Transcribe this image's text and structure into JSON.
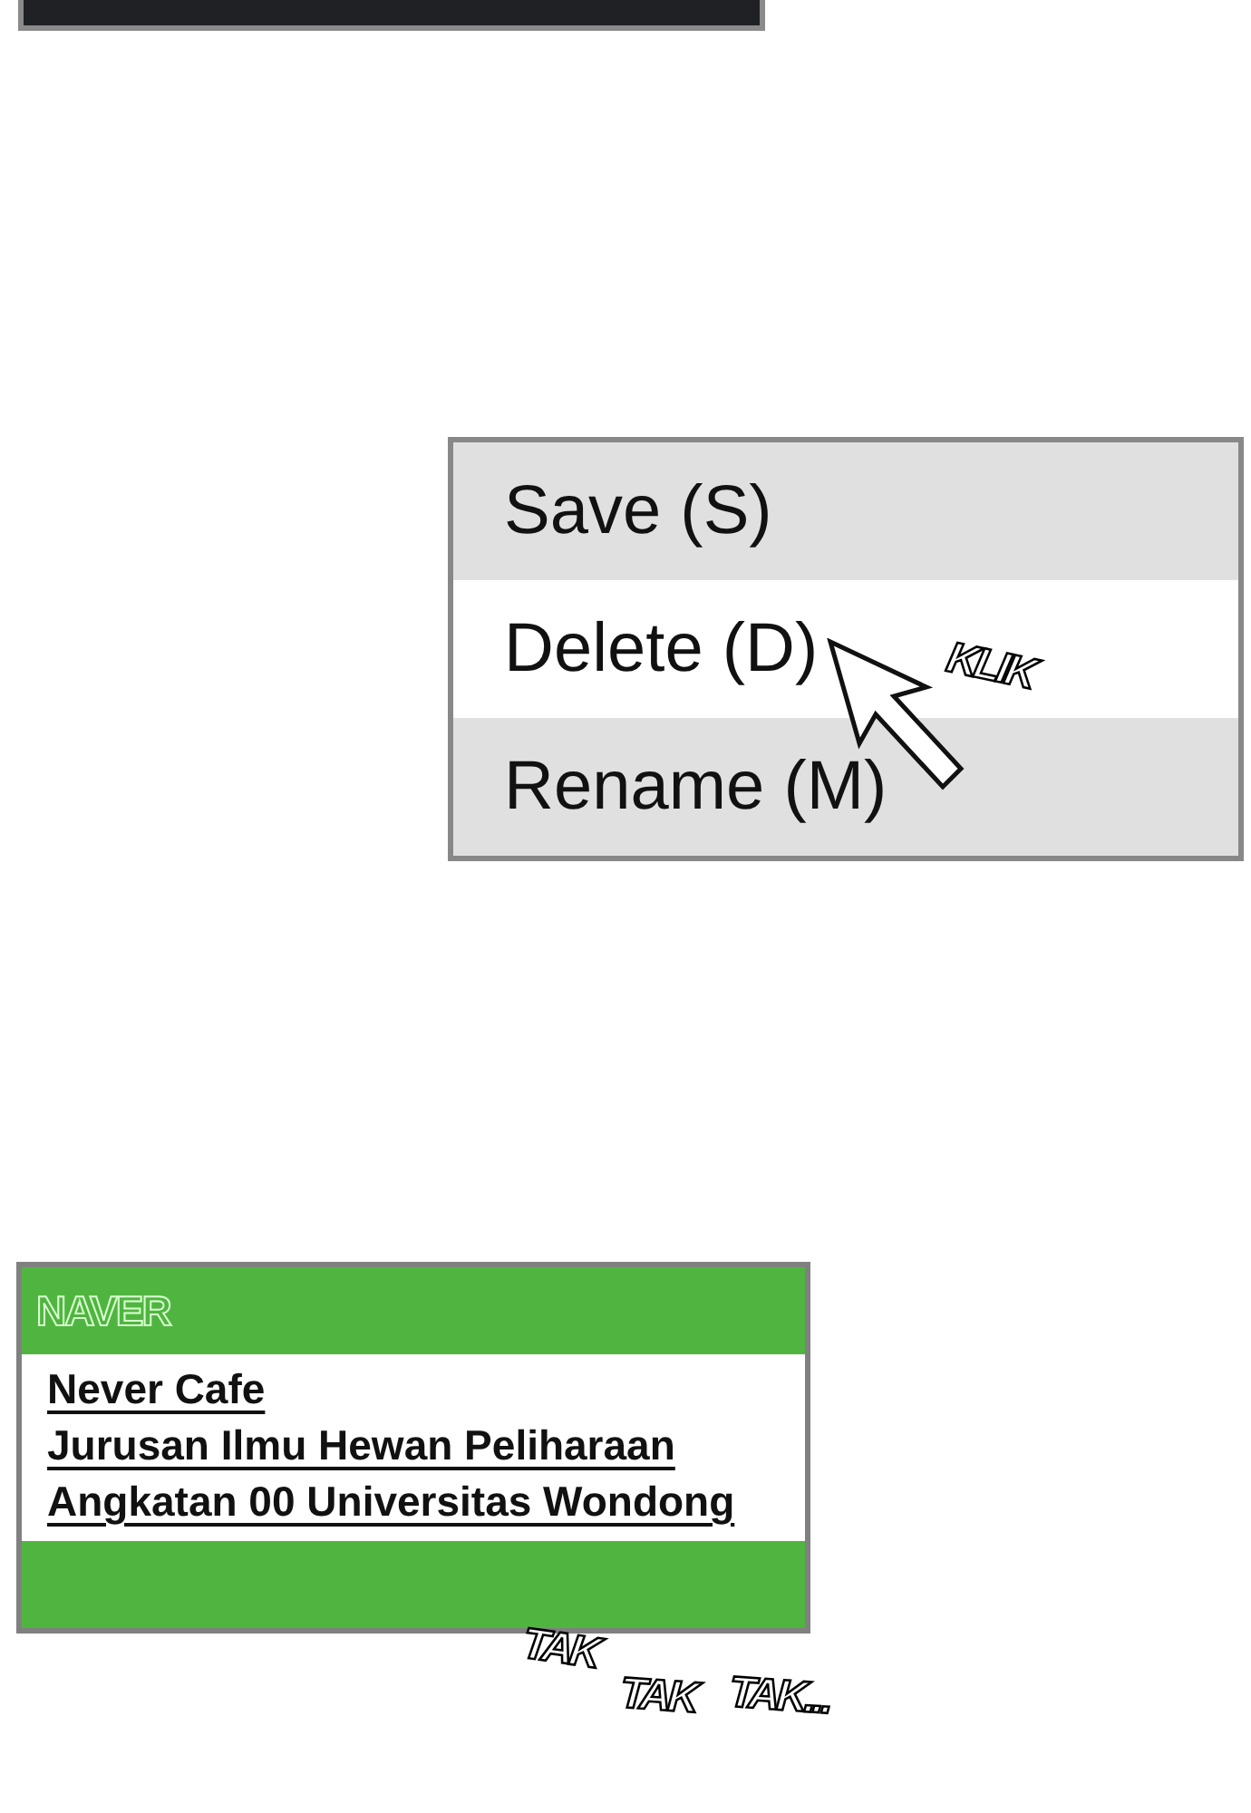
{
  "top_bar": {
    "kind": "dark"
  },
  "menu": {
    "items": [
      {
        "label": "Save (S)",
        "selected": false
      },
      {
        "label": "Delete (D)",
        "selected": true
      },
      {
        "label": "Rename (M)",
        "selected": false
      }
    ]
  },
  "cursor_sound": "KLIK",
  "browser": {
    "logo": "NAVER",
    "lines": [
      "Never Cafe",
      "Jurusan Ilmu Hewan Peliharaan",
      "Angkatan 00 Universitas Wondong"
    ]
  },
  "typing_sounds": [
    "TAK",
    "TAK",
    "TAK..."
  ]
}
